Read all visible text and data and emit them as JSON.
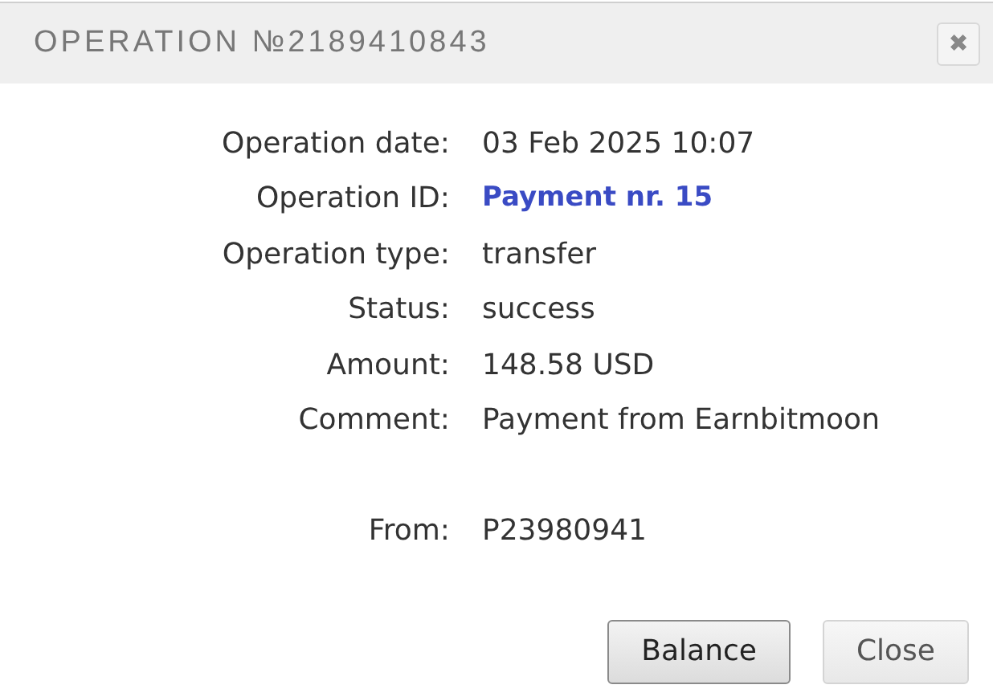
{
  "dialog": {
    "title": "OPERATION №2189410843",
    "close_icon": "✖"
  },
  "details": [
    {
      "label": "Operation date:",
      "value": "03 Feb 2025 10:07",
      "kind": "text"
    },
    {
      "label": "Operation ID:",
      "value": "Payment nr. 15",
      "kind": "link"
    },
    {
      "label": "Operation type:",
      "value": "transfer",
      "kind": "text"
    },
    {
      "label": "Status:",
      "value": "success",
      "kind": "text"
    },
    {
      "label": "Amount:",
      "value": "148.58 USD",
      "kind": "text"
    },
    {
      "label": "Comment:",
      "value": "Payment from Earnbitmoon",
      "kind": "text"
    }
  ],
  "source": {
    "label": "From:",
    "value": "P23980941"
  },
  "buttons": [
    {
      "label": "Balance",
      "focused": true
    },
    {
      "label": "Close",
      "focused": false
    }
  ]
}
